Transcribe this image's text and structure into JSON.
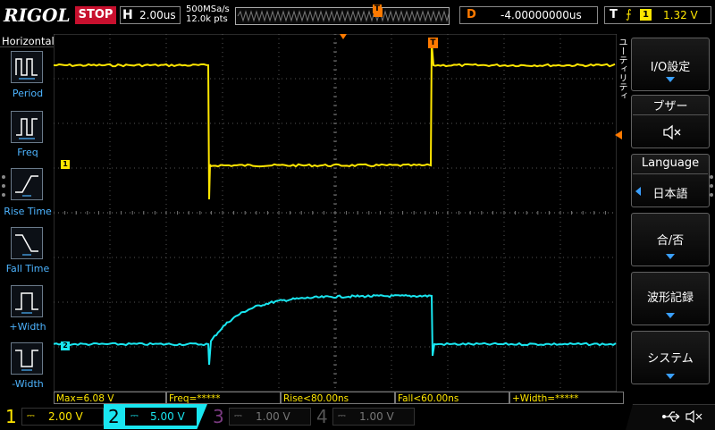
{
  "header": {
    "logo": "RIGOL",
    "run_state": "STOP",
    "timebase_label": "H",
    "timebase_value": "2.00us",
    "sample_rate": "500MSa/s",
    "memory_depth": "12.0k pts",
    "delay_label": "D",
    "delay_value": "-4.00000000us",
    "trigger_label": "T",
    "trigger_edge": "⨍",
    "trigger_source": "1",
    "trigger_level": "1.32 V"
  },
  "left_panel": {
    "title": "Horizontal",
    "items": [
      {
        "label": "Period",
        "icon": "period-icon"
      },
      {
        "label": "Freq",
        "icon": "freq-icon"
      },
      {
        "label": "Rise Time",
        "icon": "rise-time-icon"
      },
      {
        "label": "Fall Time",
        "icon": "fall-time-icon"
      },
      {
        "label": "+Width",
        "icon": "positive-width-icon"
      },
      {
        "label": "-Width",
        "icon": "negative-width-icon"
      }
    ]
  },
  "right_panel": {
    "vertical_label": "ユーティリティ",
    "items": [
      {
        "label": "I/O設定"
      },
      {
        "label": "ブザー",
        "value": "speaker-mute-icon"
      },
      {
        "label": "Language",
        "value": "日本語"
      },
      {
        "label": "合/否"
      },
      {
        "label": "波形記録"
      },
      {
        "label": "システム"
      }
    ]
  },
  "markers": {
    "ch1": "1",
    "ch2": "2",
    "trigger": "T"
  },
  "measurements": [
    "Max=6.08 V",
    "Freq=*****",
    "Rise<80.00ns",
    "Fall<60.00ns",
    "+Width=*****"
  ],
  "channels": [
    {
      "num": "1",
      "coupling": "⎓",
      "scale": "2.00 V",
      "color": "#ffe600",
      "active": true
    },
    {
      "num": "2",
      "coupling": "⎓",
      "scale": "5.00 V",
      "color": "#19e6f0",
      "active": true
    },
    {
      "num": "3",
      "coupling": "⎓",
      "scale": "1.00 V",
      "color": "#b040c0",
      "active": false
    },
    {
      "num": "4",
      "coupling": "⎓",
      "scale": "1.00 V",
      "color": "#3a6fd8",
      "active": false
    }
  ],
  "status_icons": [
    "usb-icon",
    "speaker-mute-icon"
  ],
  "colors": {
    "ch1": "#ffe600",
    "ch2": "#19e6f0",
    "accent": "#ff7a00",
    "stop": "#c8102e"
  }
}
